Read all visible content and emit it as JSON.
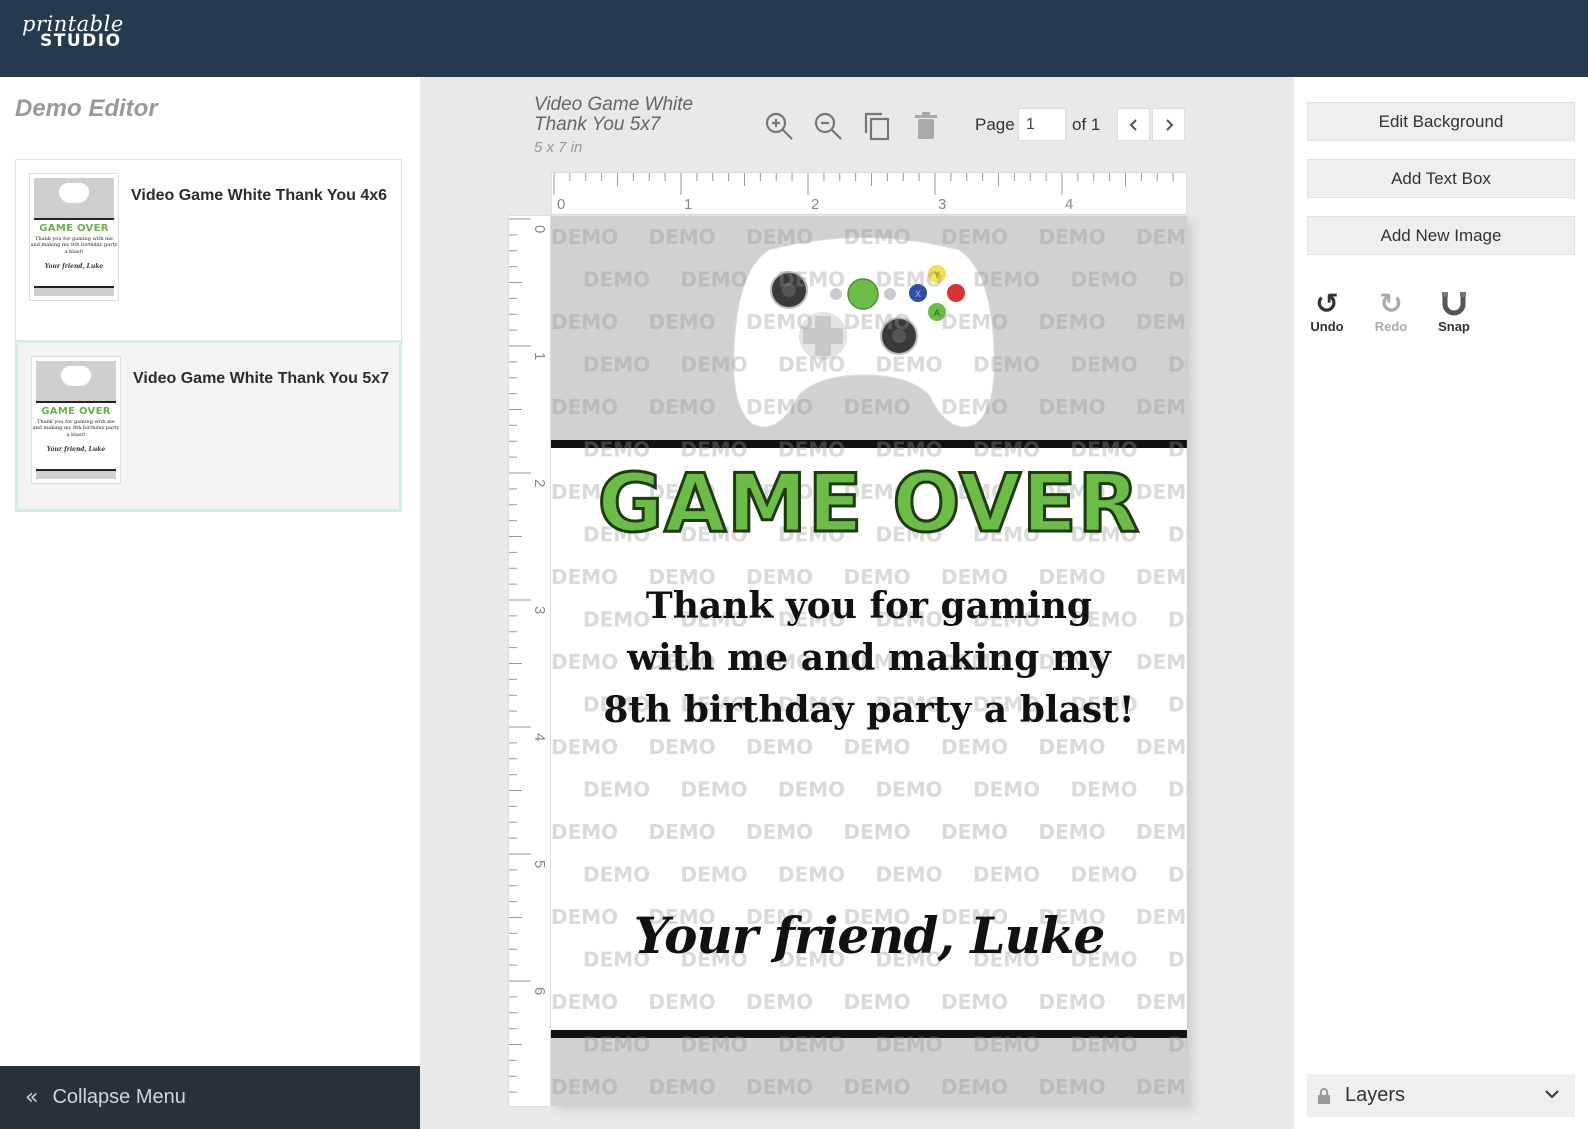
{
  "header": {
    "logo_script": "printable",
    "logo_block": "STUDIO"
  },
  "sidebar": {
    "title": "Demo Editor",
    "templates": [
      {
        "name": "Video Game White Thank You 4x6",
        "active": false
      },
      {
        "name": "Video Game White Thank You 5x7",
        "active": true
      }
    ],
    "thumb": {
      "title": "GAME OVER",
      "body": "Thank you for gaming with me and making my 8th birthday party a blast!",
      "sign": "Your friend, Luke"
    },
    "collapse_label": "Collapse Menu"
  },
  "document": {
    "title": "Video Game White Thank You 5x7",
    "size": "5 x 7 in"
  },
  "toolbar": {
    "icons": [
      "zoom-in-icon",
      "zoom-out-icon",
      "duplicate-icon",
      "trash-icon"
    ],
    "page_label": "Page",
    "page_value": "1",
    "page_of": "of 1"
  },
  "rulers": {
    "horizontal": [
      "0",
      "1",
      "2",
      "3",
      "4"
    ],
    "vertical": [
      "0",
      "1",
      "2",
      "3",
      "4",
      "5",
      "6"
    ]
  },
  "canvas": {
    "watermark": "DEMO",
    "headline": "GAME OVER",
    "message_lines": [
      "Thank you for gaming",
      "with me and making my",
      "8th birthday party a blast!"
    ],
    "signature": "Your friend, Luke",
    "controller_buttons": [
      "Y",
      "X",
      "A"
    ]
  },
  "right_panel": {
    "buttons": [
      "Edit Background",
      "Add Text Box",
      "Add New Image"
    ],
    "history": [
      {
        "label": "Undo",
        "enabled": true
      },
      {
        "label": "Redo",
        "enabled": false
      },
      {
        "label": "Snap",
        "enabled": true
      }
    ],
    "layers_label": "Layers"
  },
  "colors": {
    "header": "#263a4f",
    "accent_green": "#6cbd45",
    "collapse_bar": "#263138"
  }
}
